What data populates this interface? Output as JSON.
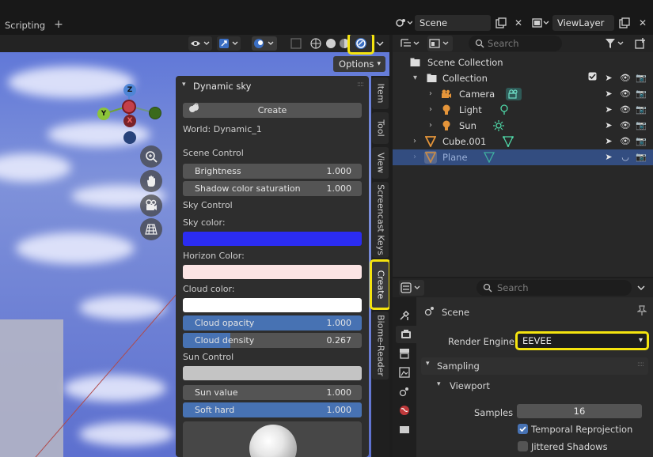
{
  "workspace": {
    "tab_label": "Scripting",
    "add_label": "+"
  },
  "scene_selector": {
    "value": "Scene"
  },
  "viewlayer_selector": {
    "value": "ViewLayer"
  },
  "viewport": {
    "options_label": "Options",
    "gizmo_axes": {
      "z": "Z",
      "y": "Y",
      "x": "X"
    }
  },
  "npanel": {
    "title": "Dynamic sky",
    "create_label": "Create",
    "world_label": "World: Dynamic_1",
    "scene_control": "Scene Control",
    "brightness": {
      "label": "Brightness",
      "value": "1.000"
    },
    "shadow": {
      "label": "Shadow color saturation",
      "value": "1.000"
    },
    "sky_control": "Sky Control",
    "sky_color": {
      "label": "Sky color:",
      "color": "#2b2cf2"
    },
    "horizon_color": {
      "label": "Horizon Color:",
      "color": "#fbe4e4"
    },
    "cloud_color": {
      "label": "Cloud color:",
      "color": "#ffffff"
    },
    "cloud_opacity": {
      "label": "Cloud opacity",
      "value": "1.000",
      "fraction": 1.0
    },
    "cloud_density": {
      "label": "Cloud density",
      "value": "0.267",
      "fraction": 0.267
    },
    "sun_control": "Sun Control",
    "sun_color": {
      "color": "#c4c4c4"
    },
    "sun_value": {
      "label": "Sun value",
      "value": "1.000"
    },
    "soft_hard": {
      "label": "Soft hard",
      "value": "1.000",
      "fraction": 1.0
    }
  },
  "side_tabs": [
    "Item",
    "Tool",
    "View",
    "Screencast Keys",
    "Create",
    "Biome-Reader"
  ],
  "outliner": {
    "search_placeholder": "Search",
    "scene_collection": "Scene Collection",
    "collection": "Collection",
    "items": [
      {
        "label": "Camera"
      },
      {
        "label": "Light"
      },
      {
        "label": "Sun"
      }
    ],
    "cube": "Cube.001",
    "plane": "Plane"
  },
  "properties": {
    "search_placeholder": "Search",
    "scene_title": "Scene",
    "render_engine_label": "Render Engine",
    "render_engine_value": "EEVEE",
    "sampling": "Sampling",
    "viewport": "Viewport",
    "samples_label": "Samples",
    "samples_value": "16",
    "temporal_reprojection": {
      "label": "Temporal Reprojection",
      "checked": true
    },
    "jittered_shadows": {
      "label": "Jittered Shadows",
      "checked": false
    }
  },
  "colors": {
    "accent_blue": "#4772b3",
    "highlight_yellow": "#f5e40f",
    "selection_row": "#334d80"
  }
}
